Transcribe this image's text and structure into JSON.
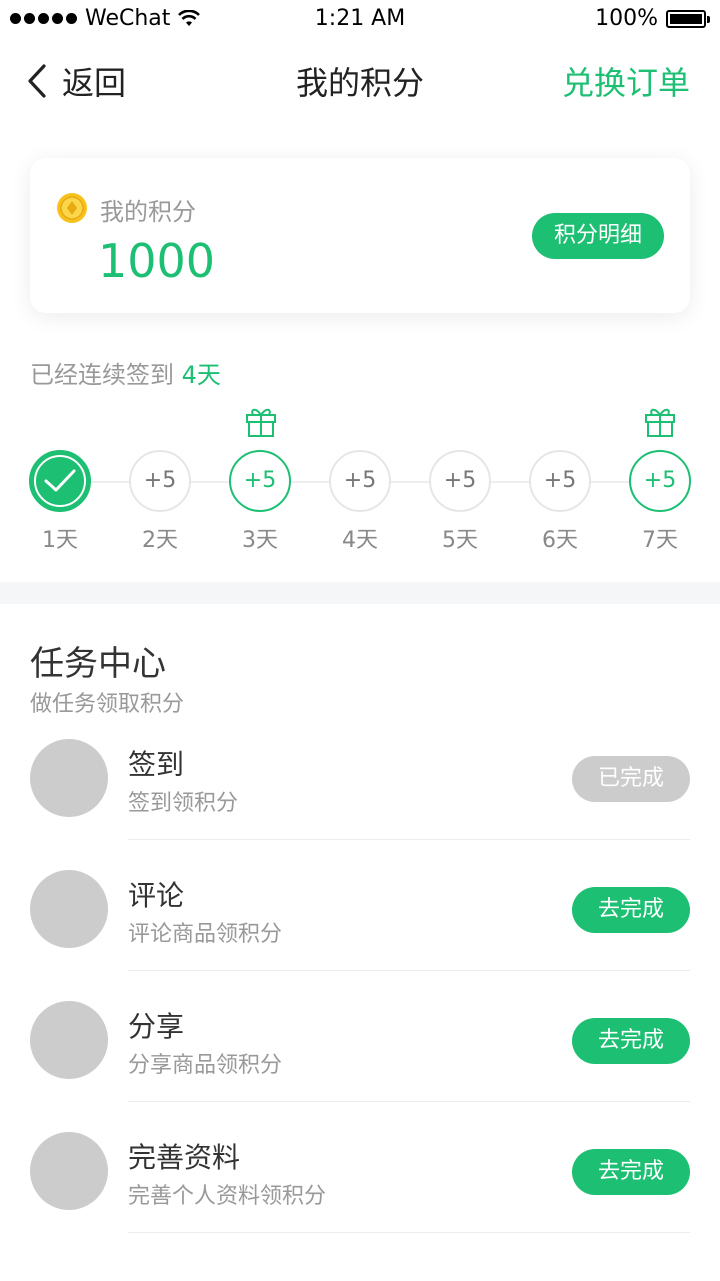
{
  "status_bar": {
    "carrier": "WeChat",
    "time": "1:21 AM",
    "battery": "100%"
  },
  "nav": {
    "back_label": "返回",
    "title": "我的积分",
    "right_label": "兑换订单"
  },
  "points_card": {
    "label": "我的积分",
    "value": "1000",
    "detail_button": "积分明细"
  },
  "streak": {
    "prefix": "已经连续签到 ",
    "days": "4天"
  },
  "days": [
    {
      "label": "1天",
      "reward": "",
      "state": "done"
    },
    {
      "label": "2天",
      "reward": "+5",
      "state": "normal"
    },
    {
      "label": "3天",
      "reward": "+5",
      "state": "gift"
    },
    {
      "label": "4天",
      "reward": "+5",
      "state": "normal"
    },
    {
      "label": "5天",
      "reward": "+5",
      "state": "normal"
    },
    {
      "label": "6天",
      "reward": "+5",
      "state": "normal"
    },
    {
      "label": "7天",
      "reward": "+5",
      "state": "gift"
    }
  ],
  "task_center": {
    "title": "任务中心",
    "subtitle": "做任务领取积分",
    "tasks": [
      {
        "name": "签到",
        "desc": "签到领积分",
        "button": "已完成",
        "completed": true
      },
      {
        "name": "评论",
        "desc": "评论商品领积分",
        "button": "去完成",
        "completed": false
      },
      {
        "name": "分享",
        "desc": "分享商品领积分",
        "button": "去完成",
        "completed": false
      },
      {
        "name": "完善资料",
        "desc": "完善个人资料领积分",
        "button": "去完成",
        "completed": false
      }
    ]
  },
  "colors": {
    "accent": "#1dbf73",
    "muted": "#999999",
    "disabled": "#cccccc"
  },
  "icons": {
    "back": "chevron-left-icon",
    "coin": "coin-icon",
    "gift": "gift-icon",
    "check": "check-icon"
  }
}
